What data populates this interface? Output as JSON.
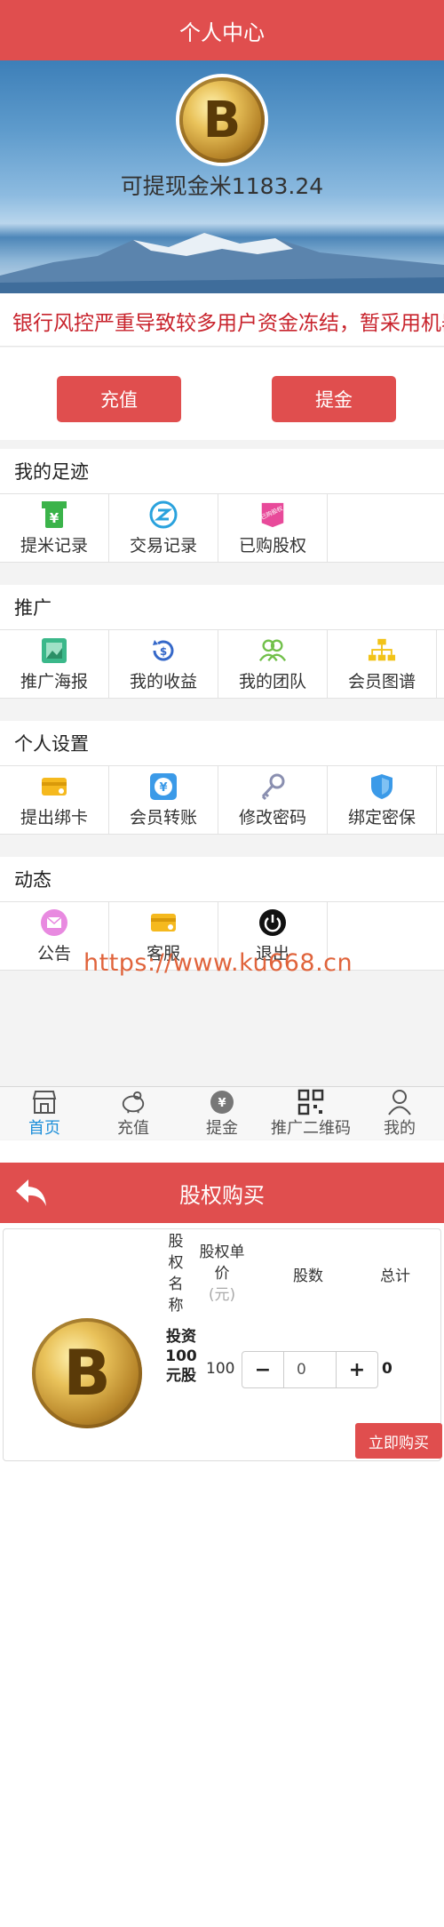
{
  "profile": {
    "title": "个人中心",
    "balance_text": "可提现金米1183.24",
    "notice_text": "银行风控严重导致较多用户资金冻结，暂采用机器",
    "recharge_label": "充值",
    "withdraw_label": "提金"
  },
  "sections": [
    {
      "title": "我的足迹",
      "items": [
        {
          "label": "提米记录",
          "icon": "atm-yen-icon"
        },
        {
          "label": "交易记录",
          "icon": "transfer-z-icon"
        },
        {
          "label": "已购股权",
          "icon": "purchased-tag-icon",
          "badge": "已购股权"
        }
      ]
    },
    {
      "title": "推广",
      "items": [
        {
          "label": "推广海报",
          "icon": "poster-image-icon"
        },
        {
          "label": "我的收益",
          "icon": "earnings-cycle-icon"
        },
        {
          "label": "我的团队",
          "icon": "team-icon"
        },
        {
          "label": "会员图谱",
          "icon": "org-chart-icon"
        }
      ]
    },
    {
      "title": "个人设置",
      "items": [
        {
          "label": "提出绑卡",
          "icon": "bank-card-icon"
        },
        {
          "label": "会员转账",
          "icon": "transfer-yen-icon"
        },
        {
          "label": "修改密码",
          "icon": "key-icon"
        },
        {
          "label": "绑定密保",
          "icon": "shield-icon"
        }
      ]
    },
    {
      "title": "动态",
      "items": [
        {
          "label": "公告",
          "icon": "mail-icon"
        },
        {
          "label": "客服",
          "icon": "service-card-icon"
        },
        {
          "label": "退出",
          "icon": "power-icon"
        }
      ]
    }
  ],
  "watermark": "https://www.ku668.cn",
  "tabbar": [
    {
      "label": "首页",
      "icon": "shop-icon",
      "active": true
    },
    {
      "label": "充值",
      "icon": "piggy-bank-icon",
      "active": false
    },
    {
      "label": "提金",
      "icon": "coin-icon",
      "active": false
    },
    {
      "label": "推广二维码",
      "icon": "qr-code-icon",
      "active": false
    },
    {
      "label": "我的",
      "icon": "user-icon",
      "active": false
    }
  ],
  "purchase": {
    "title": "股权购买",
    "col_name": "股权名称",
    "col_price": "股权单价",
    "col_price_unit": "(元)",
    "col_qty": "股数",
    "col_total": "总计",
    "product_name": "投资100元股",
    "product_price": "100",
    "qty_value": "0",
    "minus_symbol": "−",
    "plus_symbol": "+",
    "total_value": "0",
    "buy_label": "立即购买",
    "coin_letter": "B"
  },
  "colors": {
    "brand_red": "#e04e4e",
    "notice_red": "#c8232c",
    "active_tab_blue": "#1e8fd9",
    "watermark_orange": "#e0643c"
  }
}
